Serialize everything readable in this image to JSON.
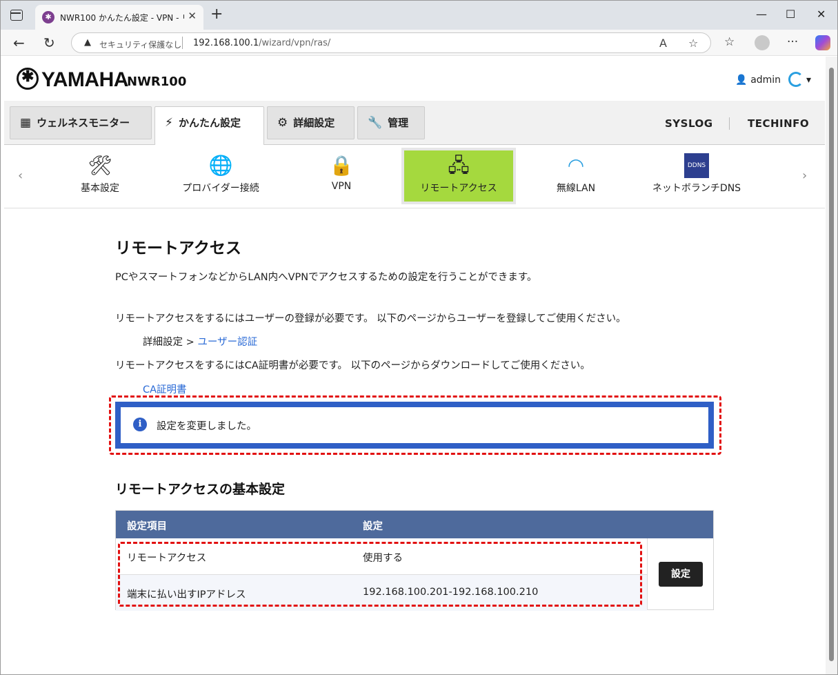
{
  "browser": {
    "tab_title": "NWR100 かんたん設定 - VPN - リモ",
    "tab_favicon": "yamaha-favicon",
    "security_label": "セキュリティ保護なし",
    "url_host": "192.168.100.1",
    "url_path": "/wizard/vpn/ras/"
  },
  "header": {
    "brand": "YAMAHA",
    "model": "NWR100",
    "user": "admin"
  },
  "main_tabs": [
    {
      "label": "ウェルネスモニター",
      "icon": "grid-icon"
    },
    {
      "label": "かんたん設定",
      "icon": "magic-wand-icon"
    },
    {
      "label": "詳細設定",
      "icon": "gear-icon"
    },
    {
      "label": "管理",
      "icon": "wrench-icon"
    }
  ],
  "header_links": [
    "SYSLOG",
    "TECHINFO"
  ],
  "sub_nav": [
    {
      "label": "基本設定",
      "icon": "tools-icon"
    },
    {
      "label": "プロバイダー接続",
      "icon": "globe-icon"
    },
    {
      "label": "VPN",
      "icon": "lock-house-icon"
    },
    {
      "label": "リモートアクセス",
      "icon": "remote-access-icon"
    },
    {
      "label": "無線LAN",
      "icon": "wifi-icon"
    },
    {
      "label": "ネットボランチDNS",
      "icon": "ddns-icon"
    }
  ],
  "content": {
    "title": "リモートアクセス",
    "intro": "PCやスマートフォンなどからLAN内へVPNでアクセスするための設定を行うことができます。",
    "user_note": "リモートアクセスをするにはユーザーの登録が必要です。 以下のページからユーザーを登録してご使用ください。",
    "user_path_prefix": "詳細設定 > ",
    "user_link": "ユーザー認証",
    "ca_note": "リモートアクセスをするにはCA証明書が必要です。 以下のページからダウンロードしてご使用ください。",
    "ca_link": "CA証明書",
    "notice": "設定を変更しました。",
    "section_title": "リモートアクセスの基本設定",
    "table": {
      "headers": [
        "設定項目",
        "設定"
      ],
      "rows": [
        [
          "リモートアクセス",
          "使用する"
        ],
        [
          "端末に払い出すIPアドレス",
          "192.168.100.201-192.168.100.210"
        ]
      ],
      "button": "設定"
    }
  }
}
